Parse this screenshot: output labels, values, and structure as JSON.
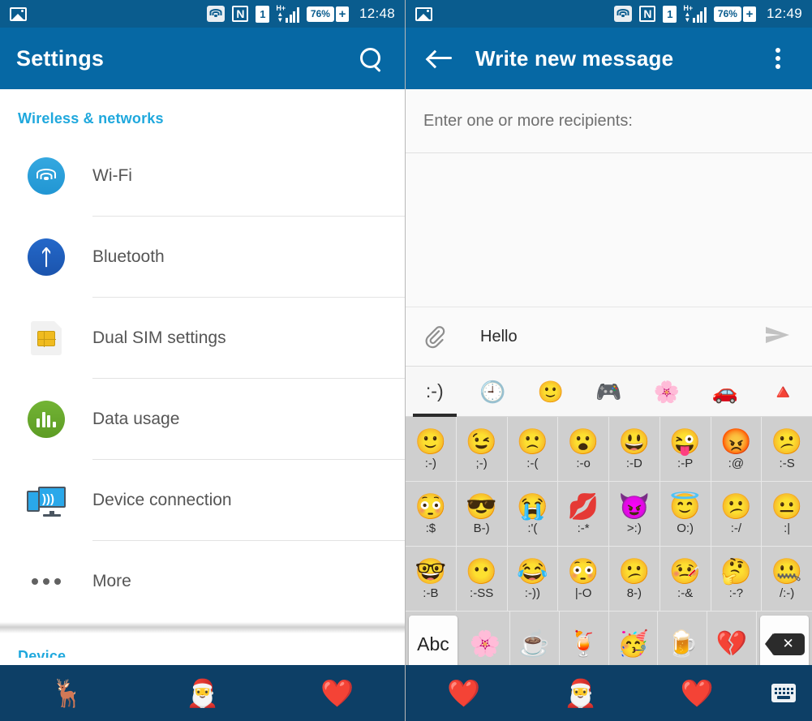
{
  "left": {
    "status_bar": {
      "photo_icon": "photo-icon",
      "wifi_icon": "wifi-icon",
      "nfc_icon": "N",
      "sim_icon": "1",
      "network_type": "H+",
      "battery_text": "76%",
      "battery_plus": "+",
      "clock": "12:48"
    },
    "appbar": {
      "title": "Settings",
      "search_icon": "search-icon"
    },
    "sections": [
      {
        "header": "Wireless & networks",
        "items": [
          {
            "label": "Wi-Fi",
            "icon": "wifi-icon"
          },
          {
            "label": "Bluetooth",
            "icon": "bluetooth-icon"
          },
          {
            "label": "Dual SIM settings",
            "icon": "sim-card-icon"
          },
          {
            "label": "Data usage",
            "icon": "bar-chart-icon"
          },
          {
            "label": "Device connection",
            "icon": "device-connection-icon"
          },
          {
            "label": "More",
            "icon": "more-dots-icon"
          }
        ]
      },
      {
        "header": "Device",
        "items": []
      }
    ],
    "navbar": [
      {
        "icon": "reindeer-icon",
        "glyph": "🦌"
      },
      {
        "icon": "santa-icon",
        "glyph": "🎅"
      },
      {
        "icon": "heart-mitten-icon",
        "glyph": "❤️"
      }
    ]
  },
  "right": {
    "status_bar": {
      "photo_icon": "photo-icon",
      "wifi_icon": "wifi-icon",
      "nfc_icon": "N",
      "sim_icon": "1",
      "network_type": "H+",
      "battery_text": "76%",
      "battery_plus": "+",
      "clock": "12:49"
    },
    "appbar": {
      "back_icon": "back-arrow-icon",
      "title": "Write new message",
      "overflow_icon": "overflow-menu-icon"
    },
    "recipients": {
      "placeholder": "Enter one or more recipients:",
      "value": ""
    },
    "compose": {
      "attach_icon": "paperclip-icon",
      "text": "Hello",
      "send_icon": "send-icon"
    },
    "emoji_tabs": [
      {
        "name": "smileys-tab",
        "glyph": ":-)",
        "active": true
      },
      {
        "name": "recent-tab",
        "glyph": "🕘",
        "active": false
      },
      {
        "name": "emoticons-tab",
        "glyph": "🙂",
        "active": false
      },
      {
        "name": "activities-tab",
        "glyph": "🎮",
        "active": false
      },
      {
        "name": "nature-tab",
        "glyph": "🌸",
        "active": false
      },
      {
        "name": "travel-tab",
        "glyph": "🚗",
        "active": false
      },
      {
        "name": "symbols-tab",
        "glyph": "🔺",
        "active": false
      }
    ],
    "emoji_rows": [
      [
        {
          "glyph": "🙂",
          "code": ":-)"
        },
        {
          "glyph": "😉",
          "code": ";-)"
        },
        {
          "glyph": "🙁",
          "code": ":-("
        },
        {
          "glyph": "😮",
          "code": ":-o"
        },
        {
          "glyph": "😃",
          "code": ":-D"
        },
        {
          "glyph": "😜",
          "code": ":-P"
        },
        {
          "glyph": "😡",
          "code": ":@"
        },
        {
          "glyph": "😕",
          "code": ":-S"
        }
      ],
      [
        {
          "glyph": "😳",
          "code": ":$"
        },
        {
          "glyph": "😎",
          "code": "B-)"
        },
        {
          "glyph": "😭",
          "code": ":'("
        },
        {
          "glyph": "💋",
          "code": ":-*"
        },
        {
          "glyph": "😈",
          "code": ">:)"
        },
        {
          "glyph": "😇",
          "code": "O:)"
        },
        {
          "glyph": "😕",
          "code": ":-/"
        },
        {
          "glyph": "😐",
          "code": ":|"
        }
      ],
      [
        {
          "glyph": "🤓",
          "code": ":-B"
        },
        {
          "glyph": "😶",
          "code": ":-SS"
        },
        {
          "glyph": "😂",
          "code": ":-))"
        },
        {
          "glyph": "😳",
          "code": "|-O"
        },
        {
          "glyph": "😕",
          "code": "8-)"
        },
        {
          "glyph": "🤒",
          "code": ":-&"
        },
        {
          "glyph": "🤔",
          "code": ":-?"
        },
        {
          "glyph": "🤐",
          "code": "/:-)"
        }
      ]
    ],
    "emoji_bottom_row": {
      "abc_key": "Abc",
      "items": [
        {
          "glyph": "🌸",
          "name": "flower-emoji"
        },
        {
          "glyph": "☕",
          "name": "coffee-emoji"
        },
        {
          "glyph": "🍹",
          "name": "cocktail-emoji"
        },
        {
          "glyph": "🥳",
          "name": "party-face-emoji"
        },
        {
          "glyph": "🍺",
          "name": "beer-emoji"
        },
        {
          "glyph": "💔",
          "name": "broken-heart-emoji"
        }
      ],
      "delete_key": "✕"
    },
    "navbar": [
      {
        "icon": "heart-mitten-icon",
        "glyph": "❤️"
      },
      {
        "icon": "santa-icon",
        "glyph": "🎅"
      },
      {
        "icon": "heart-mitten-icon",
        "glyph": "❤️"
      },
      {
        "icon": "keyboard-icon",
        "glyph": "keyboard"
      }
    ]
  },
  "colors": {
    "status_bar": "#0a5c8e",
    "app_bar": "#0668a4",
    "accent": "#1fa8dd",
    "navbar": "#0d3f66",
    "keyboard_bg": "#cfcfcf"
  }
}
